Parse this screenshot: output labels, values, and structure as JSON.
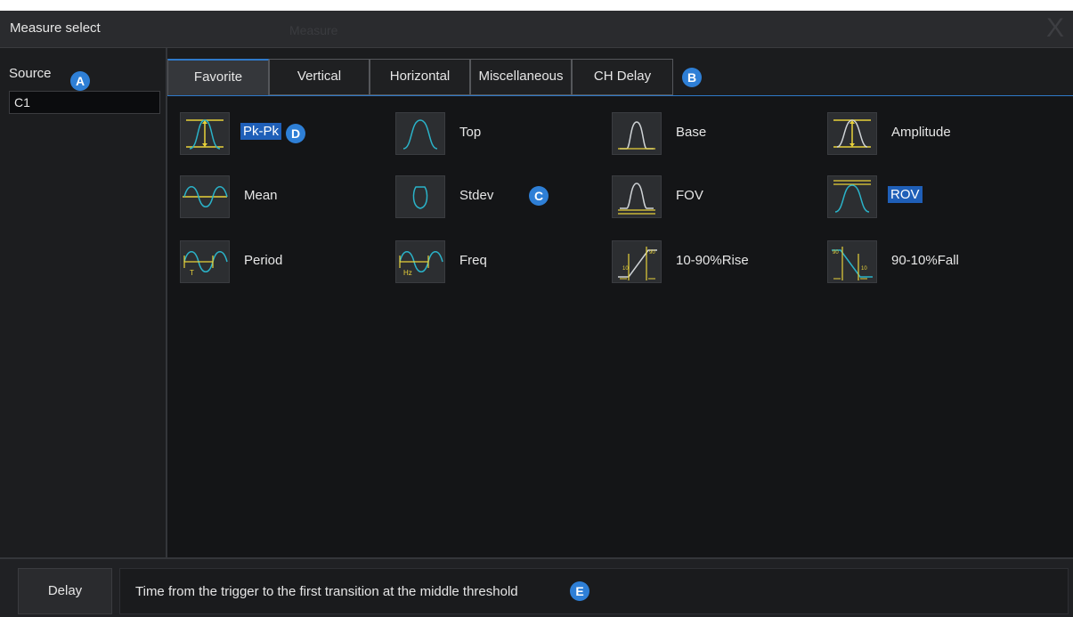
{
  "window": {
    "title": "Measure select",
    "background_title": "Measure",
    "close_glyph": "X"
  },
  "source": {
    "label": "Source",
    "value": "C1"
  },
  "tabs": [
    {
      "label": "Favorite",
      "active": true
    },
    {
      "label": "Vertical",
      "active": false
    },
    {
      "label": "Horizontal",
      "active": false
    },
    {
      "label": "Miscellaneous",
      "active": false
    },
    {
      "label": "CH Delay",
      "active": false
    }
  ],
  "measurements": [
    {
      "label": "Pk-Pk",
      "icon": "pk-pk-waveform-icon",
      "selected": true
    },
    {
      "label": "Top",
      "icon": "top-waveform-icon",
      "selected": false
    },
    {
      "label": "Base",
      "icon": "base-waveform-icon",
      "selected": false
    },
    {
      "label": "Amplitude",
      "icon": "amplitude-waveform-icon",
      "selected": false
    },
    {
      "label": "Mean",
      "icon": "mean-waveform-icon",
      "selected": false
    },
    {
      "label": "Stdev",
      "icon": "stdev-waveform-icon",
      "selected": false
    },
    {
      "label": "FOV",
      "icon": "fov-waveform-icon",
      "selected": false
    },
    {
      "label": "ROV",
      "icon": "rov-waveform-icon",
      "selected": true
    },
    {
      "label": "Period",
      "icon": "period-waveform-icon",
      "selected": false
    },
    {
      "label": "Freq",
      "icon": "freq-waveform-icon",
      "selected": false
    },
    {
      "label": "10-90%Rise",
      "icon": "rise-time-icon",
      "selected": false
    },
    {
      "label": "90-10%Fall",
      "icon": "fall-time-icon",
      "selected": false
    }
  ],
  "markers": {
    "a": "A",
    "b": "B",
    "c": "C",
    "d": "D",
    "e": "E"
  },
  "bottom": {
    "button_label": "Delay",
    "description": "Time from the trigger to the first transition at the middle threshold"
  },
  "colors": {
    "accent": "#2f79c9",
    "waveform": "#2ab3c9",
    "cursor": "#e8d23a",
    "highlight": "#1f5fb8"
  }
}
